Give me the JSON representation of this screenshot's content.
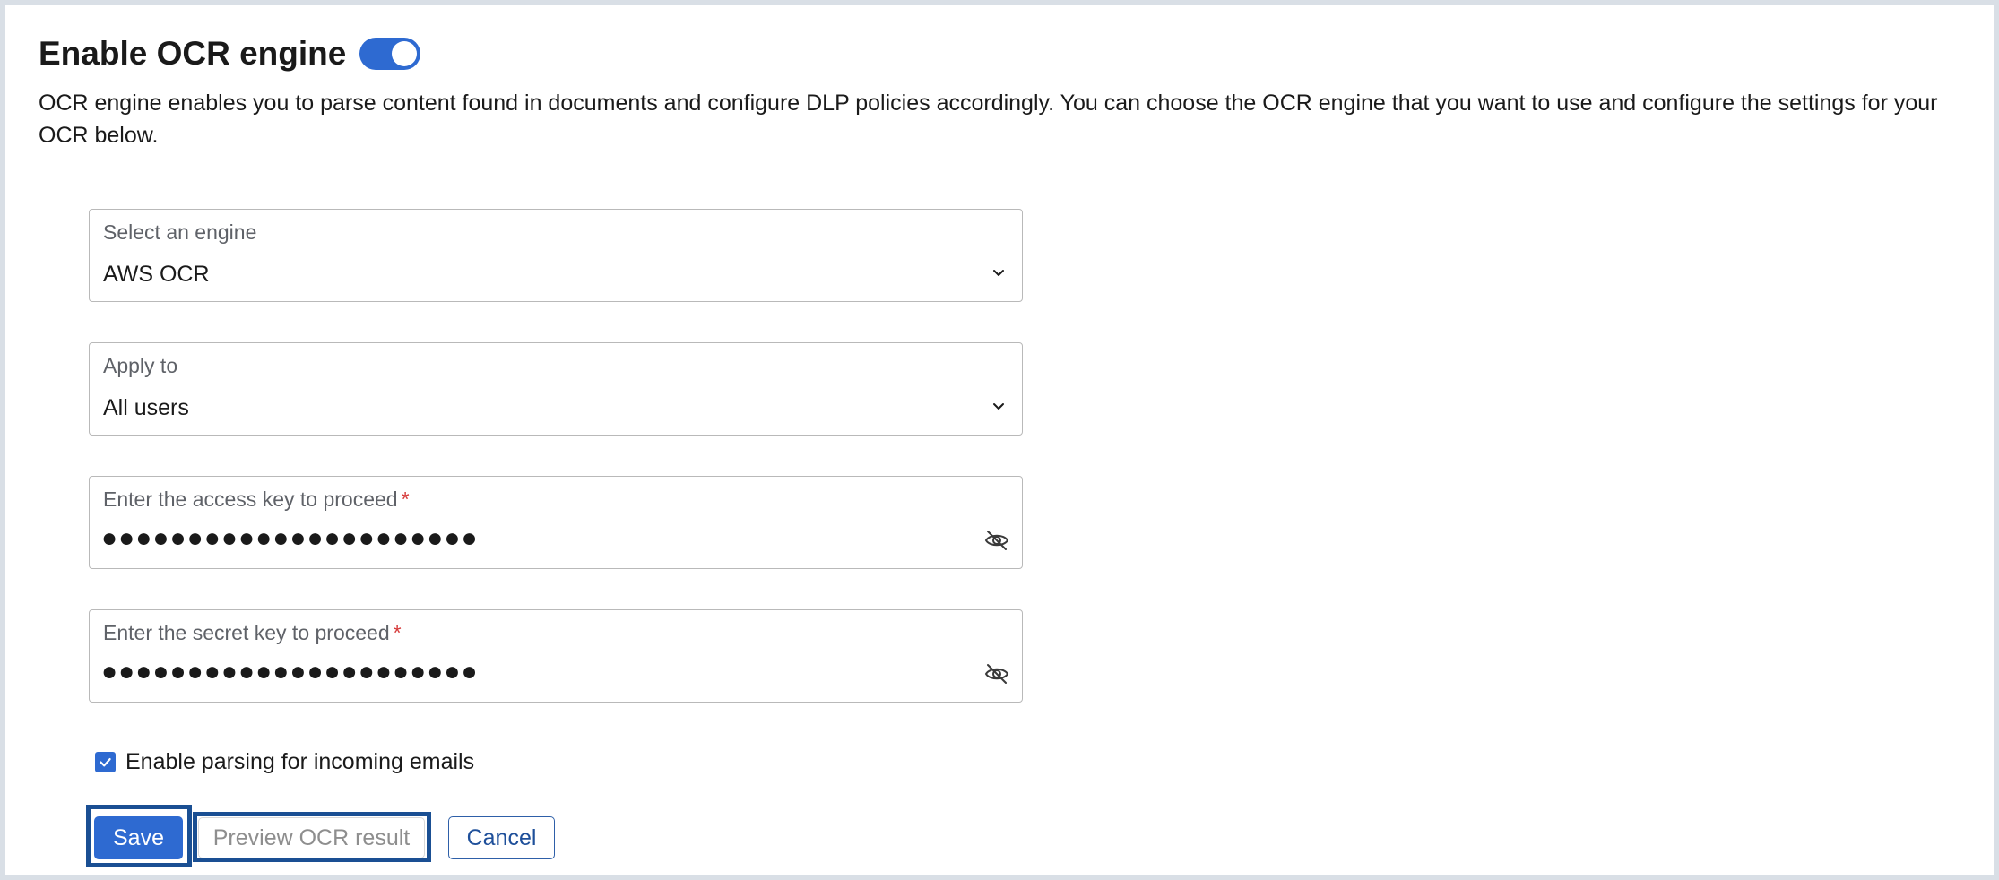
{
  "header": {
    "title": "Enable OCR engine",
    "toggle_state": "on"
  },
  "description": "OCR engine enables you to parse content found in documents and configure DLP policies accordingly. You can choose the OCR engine that you want to use and configure the settings for your OCR below.",
  "form": {
    "engine": {
      "label": "Select an engine",
      "value": "AWS OCR"
    },
    "apply_to": {
      "label": "Apply to",
      "value": "All users"
    },
    "access_key": {
      "label": "Enter the access key to proceed",
      "required_mark": "*",
      "masked_value": "●●●●●●●●●●●●●●●●●●●●●●"
    },
    "secret_key": {
      "label": "Enter the secret key to proceed",
      "required_mark": "*",
      "masked_value": "●●●●●●●●●●●●●●●●●●●●●●"
    },
    "parse_emails": {
      "label": "Enable parsing for incoming emails",
      "checked": true
    }
  },
  "actions": {
    "save_label": "Save",
    "preview_label": "Preview OCR result",
    "cancel_label": "Cancel"
  },
  "icons": {
    "dropdown": "chevron-down-icon",
    "visibility": "eye-off-icon",
    "check": "check-icon"
  },
  "colors": {
    "accent": "#2e6ad1",
    "highlight_outline": "#1a4f93",
    "required": "#d63a3a",
    "cancel_text": "#1e4f9a",
    "disabled_text": "#8e8e8e"
  }
}
